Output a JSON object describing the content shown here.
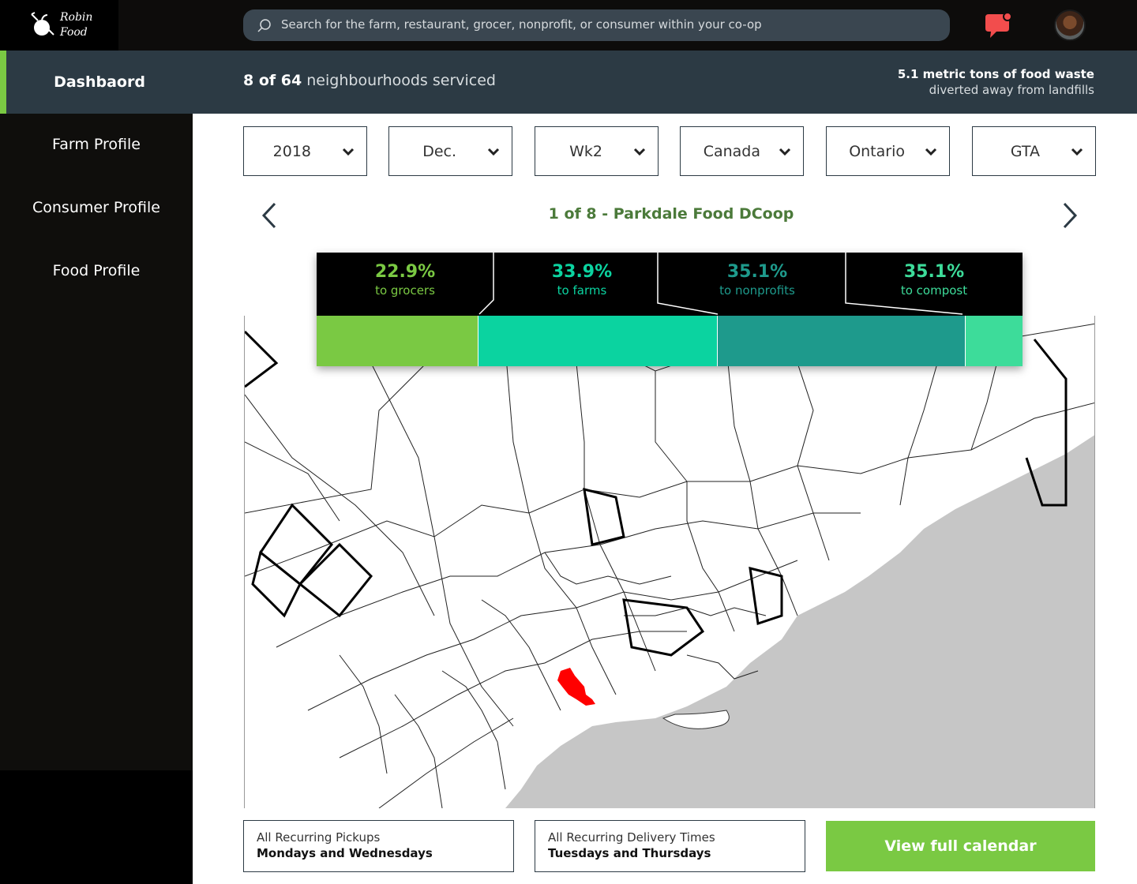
{
  "app": {
    "logo_line1": "Robin",
    "logo_line2": "Food"
  },
  "search": {
    "placeholder": "Search for the farm, restaurant, grocer, nonprofit, or consumer within your co-op"
  },
  "header": {
    "dashboard_label": "Dashbaord",
    "hood_count": "8 of 64",
    "hood_text": "neighbourhoods serviced",
    "waste_line1": "5.1 metric tons of food waste",
    "waste_line2": "diverted away from landfills"
  },
  "sidebar": {
    "items": [
      {
        "label": "Farm Profile"
      },
      {
        "label": "Consumer Profile"
      },
      {
        "label": "Food Profile"
      }
    ]
  },
  "filters": [
    {
      "value": "2018"
    },
    {
      "value": "Dec."
    },
    {
      "value": "Wk2"
    },
    {
      "value": "Canada"
    },
    {
      "value": "Ontario"
    },
    {
      "value": "GTA"
    }
  ],
  "coop": {
    "title": "1 of 8 - Parkdale Food DCoop"
  },
  "breakdown": {
    "items": [
      {
        "pct": "22.9%",
        "label": "to grocers",
        "color": "#7ac943",
        "share": 0.229
      },
      {
        "pct": "33.9%",
        "label": "to farms",
        "color": "#0bd3a0",
        "share": 0.339
      },
      {
        "pct": "35.1%",
        "label": "to nonprofits",
        "color": "#1e9a8c",
        "share": 0.351
      },
      {
        "pct": "35.1%",
        "label": "to compost",
        "color": "#3ddc9a",
        "share": 0.081
      }
    ]
  },
  "schedule": {
    "pickups_title": "All Recurring Pickups",
    "pickups_value": "Mondays and Wednesdays",
    "delivery_title": "All Recurring Delivery Times",
    "delivery_value": "Tuesdays and Thursdays"
  },
  "calendar_button": "View full calendar",
  "colors": {
    "accent": "#7ac943",
    "header": "#2c3a44",
    "highlight_region": "#ff0000",
    "lake": "#c6c6c6"
  },
  "icons": [
    "apple-logo-icon",
    "search-icon",
    "chat-notification-icon",
    "chevron-down-icon",
    "chevron-left-icon",
    "chevron-right-icon"
  ]
}
